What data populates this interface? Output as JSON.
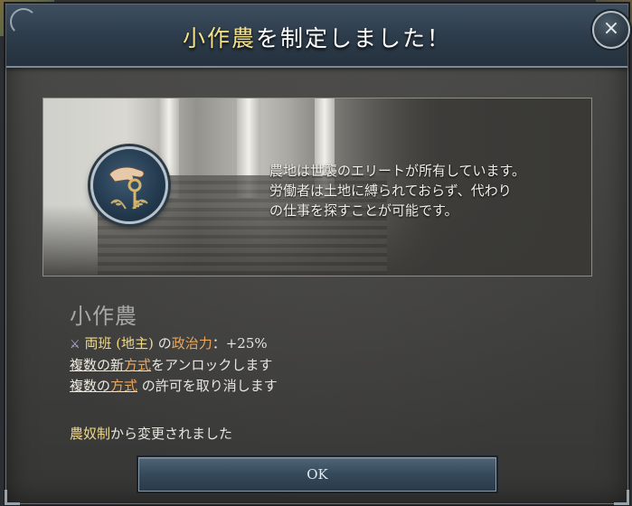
{
  "dialog": {
    "title_highlight": "小作農",
    "title_rest": "を制定しました！",
    "close_icon": "×"
  },
  "event": {
    "image_icon": "hand-with-key-medal",
    "description_lines": [
      "農地は世襲のエリートが所有しています。",
      "労働者は土地に縛られておらず、代わり",
      "の仕事を探すことが可能です。"
    ]
  },
  "law": {
    "name": "小作農",
    "effect_icon": "⚔",
    "effects": [
      {
        "group": "両班 (地主)",
        "connector": " の",
        "stat": "政治力",
        "value": "：+25%"
      },
      {
        "link_prefix": "複数の新",
        "link_highlight": "方式",
        "suffix": "をアンロックします"
      },
      {
        "link_prefix": "複数の",
        "link_highlight": "方式",
        "suffix": " の許可を取り消します"
      }
    ],
    "changed_from_name": "農奴制",
    "changed_from_suffix": "から変更されました"
  },
  "ok_button": {
    "label": "OK"
  },
  "colors": {
    "title_highlight": "#f3e28b",
    "stat_orange": "#e9a65e",
    "header_blue": "#2c3b4a",
    "panel_gray": "#3f3f3e"
  }
}
